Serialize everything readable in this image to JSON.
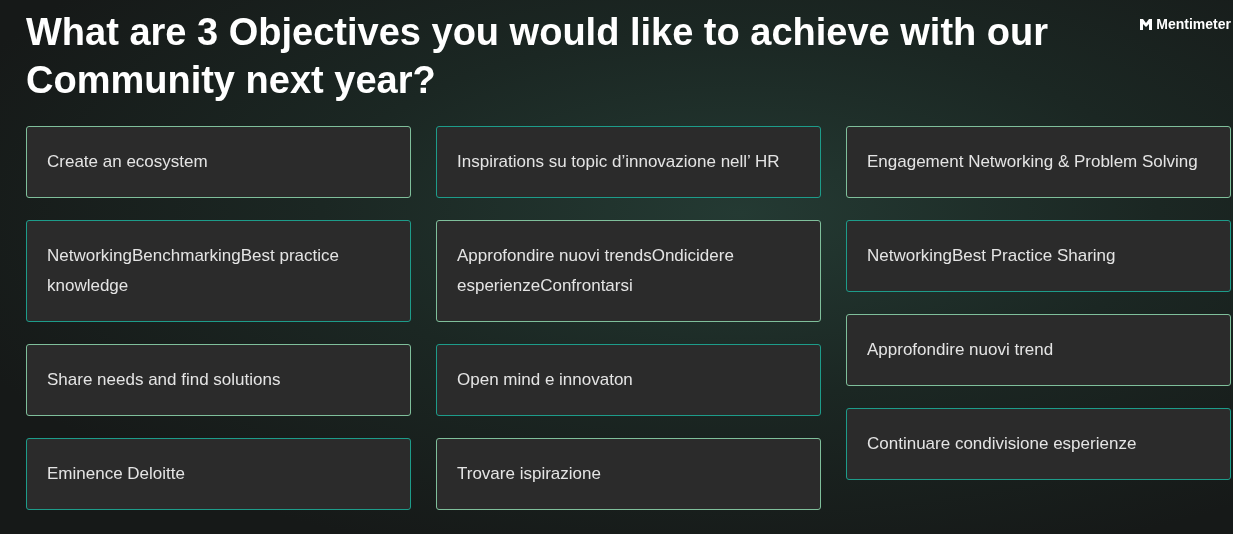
{
  "title": "What are 3 Objectives you would like to achieve with our Community next year?",
  "brand": {
    "name": "Mentimeter"
  },
  "columns": [
    [
      {
        "text": "Create an ecosystem"
      },
      {
        "text": "NetworkingBenchmarkingBest practice knowledge"
      },
      {
        "text": "Share needs and find solutions"
      },
      {
        "text": "Eminence Deloitte"
      }
    ],
    [
      {
        "text": "Inspirations su topic d’innovazione nell’ HR"
      },
      {
        "text": "Approfondire nuovi trendsOndicidere esperienzeConfrontarsi"
      },
      {
        "text": "Open mind e innovaton"
      },
      {
        "text": "Trovare ispirazione"
      }
    ],
    [
      {
        "text": "Engagement Networking & Problem Solving"
      },
      {
        "text": "NetworkingBest Practice Sharing"
      },
      {
        "text": "Approfondire nuovi trend"
      },
      {
        "text": "Continuare condivisione esperienze"
      }
    ]
  ]
}
